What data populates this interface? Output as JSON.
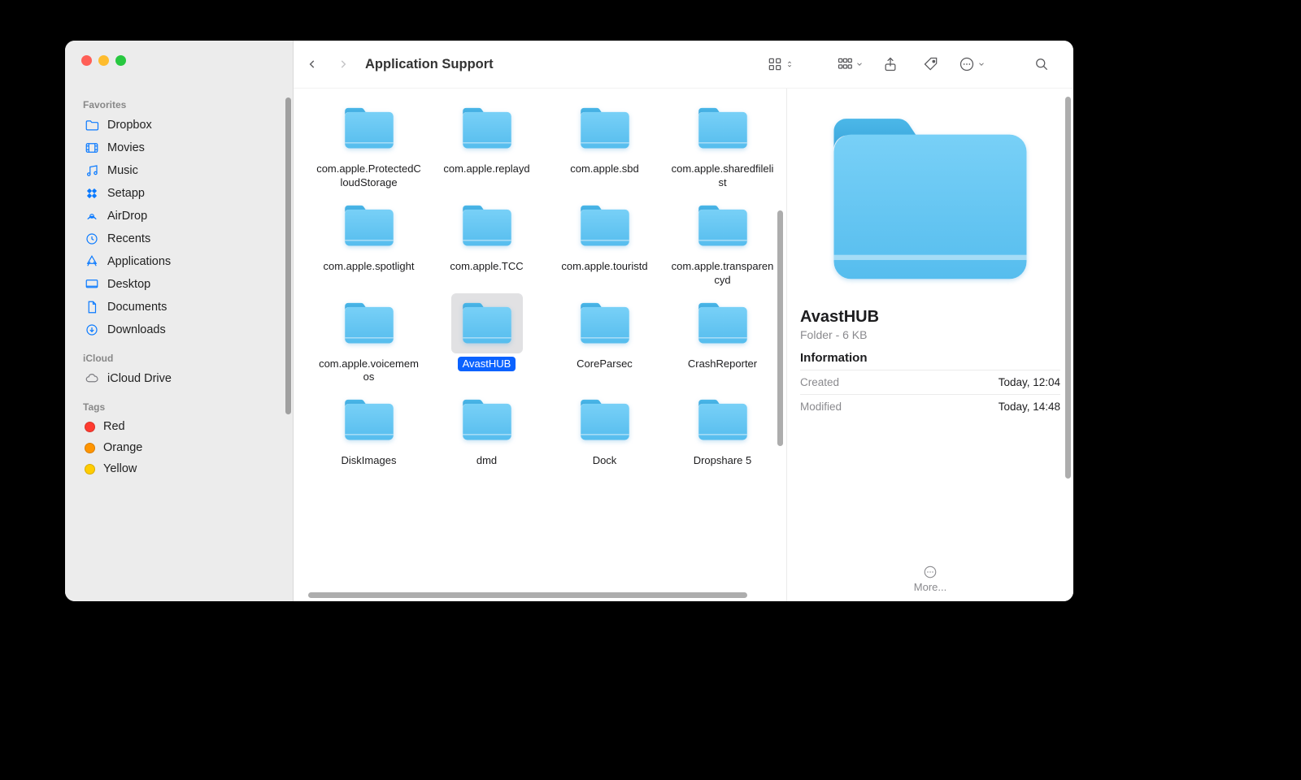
{
  "title": "Application Support",
  "sidebar": {
    "sections": [
      {
        "header": "Favorites",
        "items": [
          {
            "label": "Dropbox",
            "icon": "folder-icon"
          },
          {
            "label": "Movies",
            "icon": "movies-icon"
          },
          {
            "label": "Music",
            "icon": "music-icon"
          },
          {
            "label": "Setapp",
            "icon": "setapp-icon"
          },
          {
            "label": "AirDrop",
            "icon": "airdrop-icon"
          },
          {
            "label": "Recents",
            "icon": "recents-icon"
          },
          {
            "label": "Applications",
            "icon": "applications-icon"
          },
          {
            "label": "Desktop",
            "icon": "desktop-icon"
          },
          {
            "label": "Documents",
            "icon": "documents-icon"
          },
          {
            "label": "Downloads",
            "icon": "downloads-icon"
          }
        ]
      },
      {
        "header": "iCloud",
        "items": [
          {
            "label": "iCloud Drive",
            "icon": "cloud-icon",
            "gray": true
          }
        ]
      },
      {
        "header": "Tags",
        "items": [
          {
            "label": "Red",
            "tag": "#ff3b30"
          },
          {
            "label": "Orange",
            "tag": "#ff9500"
          },
          {
            "label": "Yellow",
            "tag": "#ffcc00"
          }
        ]
      }
    ]
  },
  "items": [
    {
      "name": "com.apple.ProtectedCloudStorage"
    },
    {
      "name": "com.apple.replayd"
    },
    {
      "name": "com.apple.sbd"
    },
    {
      "name": "com.apple.sharedfilelist"
    },
    {
      "name": "com.apple.spotlight"
    },
    {
      "name": "com.apple.TCC"
    },
    {
      "name": "com.apple.touristd"
    },
    {
      "name": "com.apple.transparencyd"
    },
    {
      "name": "com.apple.voicememos"
    },
    {
      "name": "AvastHUB",
      "selected": true
    },
    {
      "name": "CoreParsec"
    },
    {
      "name": "CrashReporter"
    },
    {
      "name": "DiskImages"
    },
    {
      "name": "dmd"
    },
    {
      "name": "Dock"
    },
    {
      "name": "Dropshare 5"
    }
  ],
  "preview": {
    "name": "AvastHUB",
    "sub": "Folder - 6 KB",
    "info_header": "Information",
    "rows": [
      {
        "k": "Created",
        "v": "Today, 12:04"
      },
      {
        "k": "Modified",
        "v": "Today, 14:48"
      }
    ],
    "more": "More..."
  }
}
